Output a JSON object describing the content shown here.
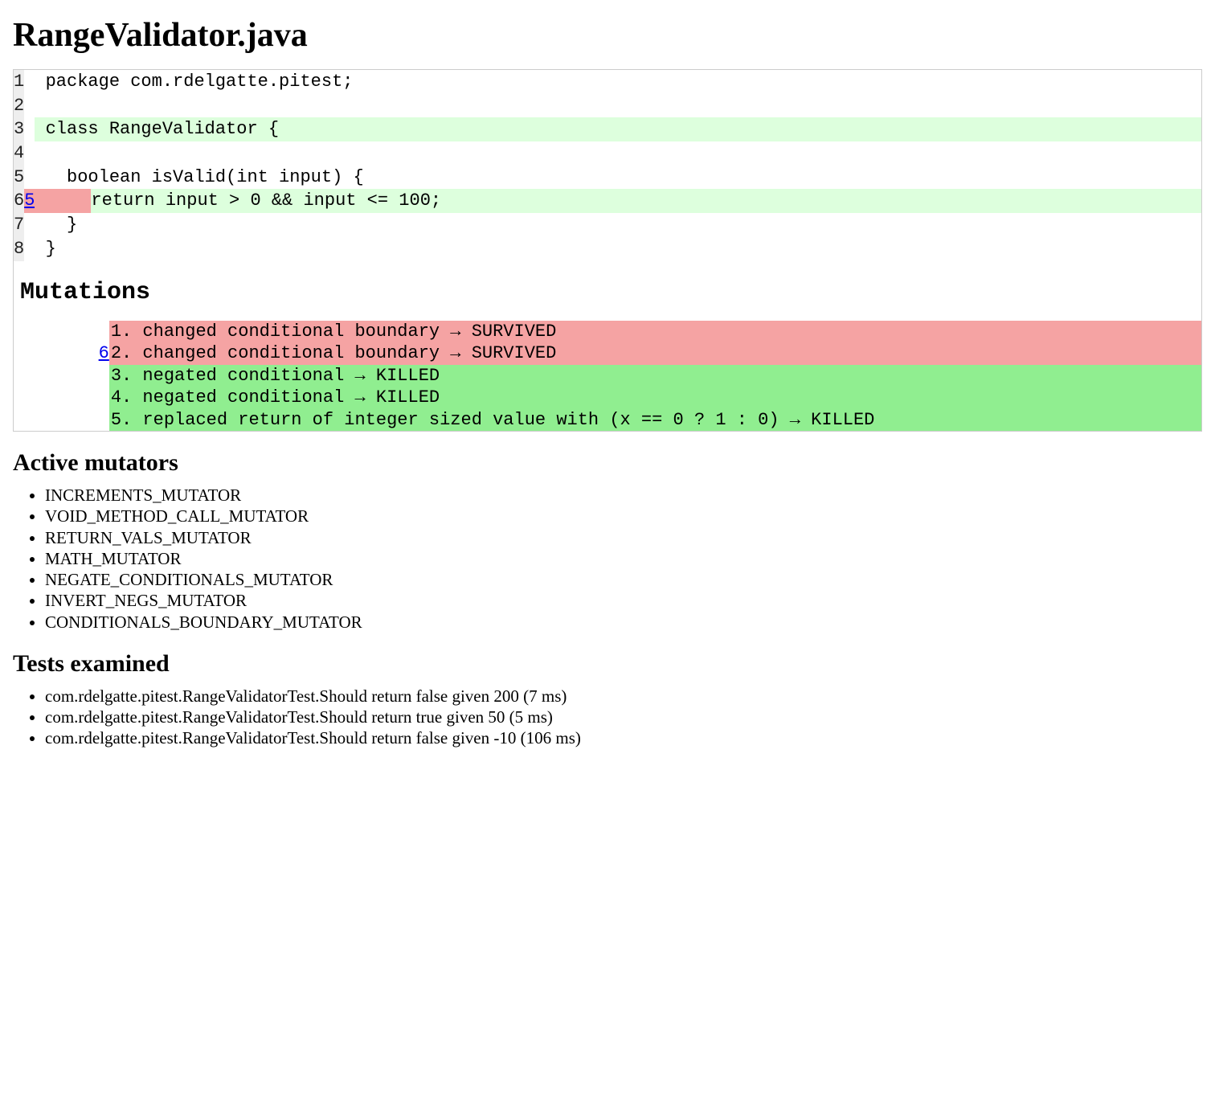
{
  "title": "RangeValidator.java",
  "source": {
    "lines": [
      {
        "n": "1",
        "mut": "",
        "code": " package com.rdelgatte.pitest;",
        "cls": ""
      },
      {
        "n": "2",
        "mut": "",
        "code": " ",
        "cls": ""
      },
      {
        "n": "3",
        "mut": "",
        "code": " class RangeValidator {",
        "cls": "covered"
      },
      {
        "n": "4",
        "mut": "",
        "code": " ",
        "cls": ""
      },
      {
        "n": "5",
        "mut": "",
        "code": "   boolean isValid(int input) {",
        "cls": ""
      },
      {
        "n": "6",
        "mut": "5",
        "prefix": "     ",
        "rest": "return input > 0 && input <= 100;",
        "cls": "line6"
      },
      {
        "n": "7",
        "mut": "",
        "code": "   }",
        "cls": ""
      },
      {
        "n": "8",
        "mut": "",
        "code": " }",
        "cls": ""
      }
    ]
  },
  "mutations_heading": "Mutations",
  "mutations": {
    "line_ref": "6",
    "items": [
      {
        "text": "1. changed conditional boundary → SURVIVED",
        "status": "surv"
      },
      {
        "text": "2. changed conditional boundary → SURVIVED",
        "status": "surv"
      },
      {
        "text": "3. negated conditional → KILLED",
        "status": "killed"
      },
      {
        "text": "4. negated conditional → KILLED",
        "status": "killed"
      },
      {
        "text": "5. replaced return of integer sized value with (x == 0 ? 1 : 0) → KILLED",
        "status": "killed"
      }
    ]
  },
  "active_mutators_heading": "Active mutators",
  "active_mutators": [
    "INCREMENTS_MUTATOR",
    "VOID_METHOD_CALL_MUTATOR",
    "RETURN_VALS_MUTATOR",
    "MATH_MUTATOR",
    "NEGATE_CONDITIONALS_MUTATOR",
    "INVERT_NEGS_MUTATOR",
    "CONDITIONALS_BOUNDARY_MUTATOR"
  ],
  "tests_heading": "Tests examined",
  "tests": [
    "com.rdelgatte.pitest.RangeValidatorTest.Should return false given 200 (7 ms)",
    "com.rdelgatte.pitest.RangeValidatorTest.Should return true given 50 (5 ms)",
    "com.rdelgatte.pitest.RangeValidatorTest.Should return false given -10 (106 ms)"
  ]
}
